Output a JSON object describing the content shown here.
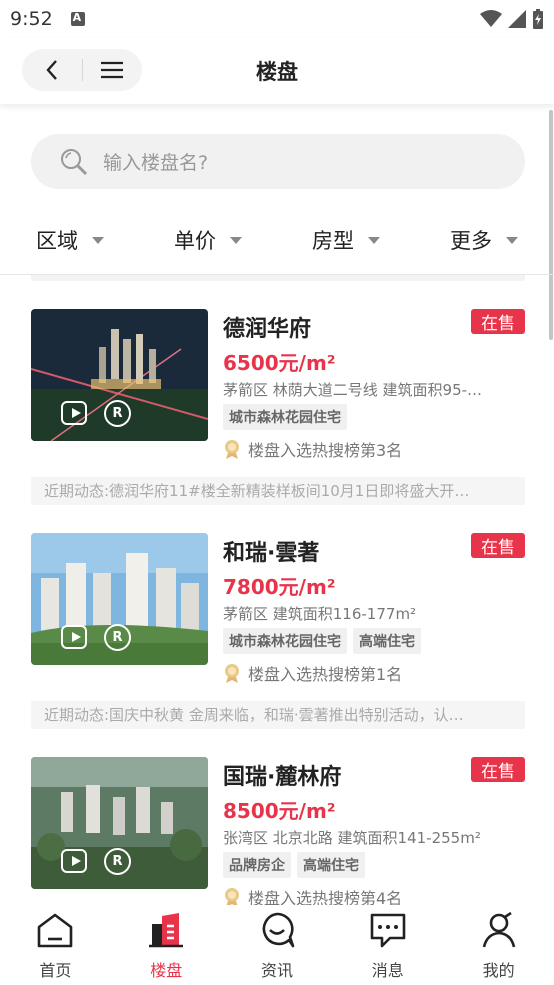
{
  "status_bar": {
    "time": "9:52"
  },
  "nav": {
    "title": "楼盘"
  },
  "search": {
    "placeholder": "输入楼盘名?"
  },
  "filters": [
    {
      "label": "区域"
    },
    {
      "label": "单价"
    },
    {
      "label": "房型"
    },
    {
      "label": "更多"
    }
  ],
  "listings": [
    {
      "name": "德润华府",
      "status": "在售",
      "price": "6500元/m²",
      "address": "茅箭区 林荫大道二号线 建筑面积95-…",
      "tags": [
        "城市森林花园住宅"
      ],
      "rank": "楼盘入选热搜榜第3名",
      "news": "近期动态:德润华府11#楼全新精装样板间10月1日即将盛大开…"
    },
    {
      "name": "和瑞·雲著",
      "status": "在售",
      "price": "7800元/m²",
      "address": "茅箭区 建筑面积116-177m²",
      "tags": [
        "城市森林花园住宅",
        "高端住宅"
      ],
      "rank": "楼盘入选热搜榜第1名",
      "news": "近期动态:国庆中秋黄 金周来临，和瑞·雲著推出特别活动，认…"
    },
    {
      "name": "国瑞·麓林府",
      "status": "在售",
      "price": "8500元/m²",
      "address": "张湾区 北京北路 建筑面积141-255m²",
      "tags": [
        "品牌房企",
        "高端住宅"
      ],
      "rank": "楼盘入选热搜榜第4名",
      "news": ""
    }
  ],
  "tabbar": [
    {
      "label": "首页",
      "icon": "home-icon",
      "active": false
    },
    {
      "label": "楼盘",
      "icon": "building-icon",
      "active": true
    },
    {
      "label": "资讯",
      "icon": "chat-bubble-icon",
      "active": false
    },
    {
      "label": "消息",
      "icon": "message-icon",
      "active": false
    },
    {
      "label": "我的",
      "icon": "user-icon",
      "active": false
    }
  ],
  "colors": {
    "accent": "#e8344a",
    "muted_text": "#777777"
  }
}
